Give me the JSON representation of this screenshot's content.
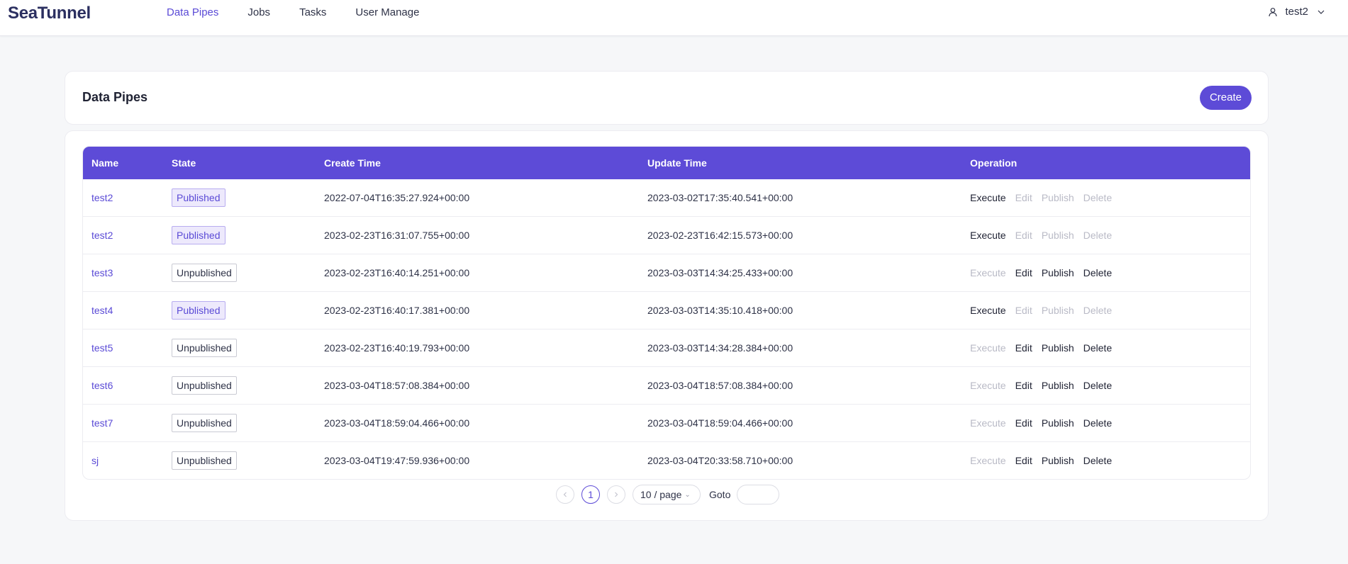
{
  "app": {
    "logo": "SeaTunnel"
  },
  "nav": {
    "items": [
      "Data Pipes",
      "Jobs",
      "Tasks",
      "User Manage"
    ],
    "active": "Data Pipes"
  },
  "user": {
    "name": "test2"
  },
  "page": {
    "title": "Data Pipes",
    "create_label": "Create"
  },
  "table": {
    "columns": [
      "Name",
      "State",
      "Create Time",
      "Update Time",
      "Operation"
    ],
    "operations": [
      "Execute",
      "Edit",
      "Publish",
      "Delete"
    ],
    "rows": [
      {
        "name": "test2",
        "state": "Published",
        "create_time": "2022-07-04T16:35:27.924+00:00",
        "update_time": "2023-03-02T17:35:40.541+00:00"
      },
      {
        "name": "test2",
        "state": "Published",
        "create_time": "2023-02-23T16:31:07.755+00:00",
        "update_time": "2023-02-23T16:42:15.573+00:00"
      },
      {
        "name": "test3",
        "state": "Unpublished",
        "create_time": "2023-02-23T16:40:14.251+00:00",
        "update_time": "2023-03-03T14:34:25.433+00:00"
      },
      {
        "name": "test4",
        "state": "Published",
        "create_time": "2023-02-23T16:40:17.381+00:00",
        "update_time": "2023-03-03T14:35:10.418+00:00"
      },
      {
        "name": "test5",
        "state": "Unpublished",
        "create_time": "2023-02-23T16:40:19.793+00:00",
        "update_time": "2023-03-03T14:34:28.384+00:00"
      },
      {
        "name": "test6",
        "state": "Unpublished",
        "create_time": "2023-03-04T18:57:08.384+00:00",
        "update_time": "2023-03-04T18:57:08.384+00:00"
      },
      {
        "name": "test7",
        "state": "Unpublished",
        "create_time": "2023-03-04T18:59:04.466+00:00",
        "update_time": "2023-03-04T18:59:04.466+00:00"
      },
      {
        "name": "sj",
        "state": "Unpublished",
        "create_time": "2023-03-04T19:47:59.936+00:00",
        "update_time": "2023-03-04T20:33:58.710+00:00"
      }
    ]
  },
  "pagination": {
    "current_page": "1",
    "page_size": "10 / page",
    "goto_label": "Goto",
    "goto_value": ""
  },
  "colors": {
    "accent": "#5d4bd7",
    "disabled": "#b9bac6"
  },
  "icons": {
    "user": "user-icon",
    "dropdown": "chevron-down-icon",
    "prev": "chevron-left-icon",
    "next": "chevron-right-icon"
  }
}
